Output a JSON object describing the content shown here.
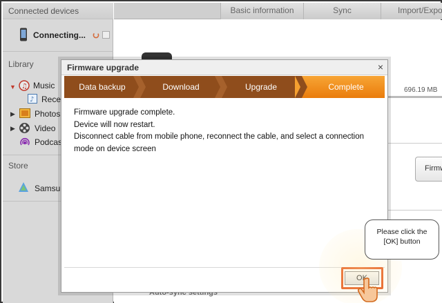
{
  "sidebar": {
    "connected_header": "Connected devices",
    "device_status": "Connecting...",
    "library_header": "Library",
    "library_items": [
      "Music",
      "Recen",
      "Photos",
      "Video",
      "Podcast"
    ],
    "store_header": "Store",
    "store_item": "Samsung"
  },
  "tabs": [
    "Basic information",
    "Sync",
    "Import/Expo"
  ],
  "main": {
    "storage_text": "696.19 MB",
    "side_button": "Firmw",
    "section_label": "Auto-sync settings"
  },
  "dialog": {
    "title": "Firmware upgrade",
    "close_glyph": "×",
    "steps": [
      "Data backup",
      "Download",
      "Upgrade",
      "Complete"
    ],
    "active_step": "Complete",
    "messages": [
      "Firmware upgrade complete.",
      "Device will now restart.",
      "Disconnect cable from mobile phone, reconnect the cable, and select a connection mode on device screen"
    ],
    "ok_label": "OK"
  },
  "callout": {
    "text_line1": "Please click the",
    "text_line2": "[OK] button"
  },
  "colors": {
    "accent": "#e55a1e",
    "step_dark": "#8f4d1c",
    "step_active": "#f39420"
  }
}
